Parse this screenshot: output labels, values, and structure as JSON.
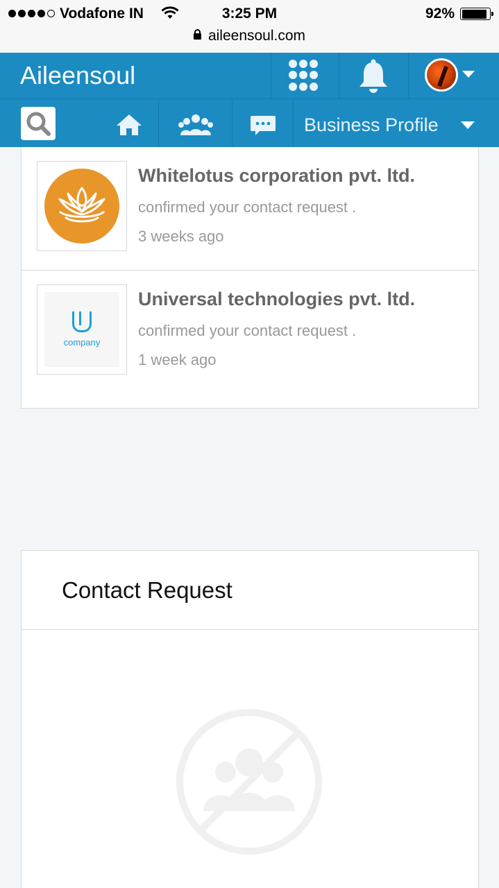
{
  "status_bar": {
    "carrier": "Vodafone IN",
    "time": "3:25 PM",
    "battery": "92%",
    "battery_level": 0.92,
    "url": "aileensoul.com"
  },
  "header": {
    "brand": "Aileensoul",
    "icons": [
      "apps-grid-icon",
      "bell-icon",
      "avatar"
    ]
  },
  "nav": {
    "icons": [
      "search-icon",
      "home-icon",
      "people-icon",
      "chat-icon"
    ],
    "profile_menu": "Business Profile"
  },
  "notifications": [
    {
      "company": "Whitelotus corporation pvt. ltd.",
      "message": "confirmed your contact request .",
      "time": "3 weeks ago",
      "logo": "lotus-logo"
    },
    {
      "company": "Universal technologies pvt. ltd.",
      "message": "confirmed your contact request .",
      "time": "1 week ago",
      "logo": "u-company-logo",
      "logo_text": "company"
    }
  ],
  "contact_request": {
    "title": "Contact Request",
    "empty_icon": "no-people-icon"
  },
  "colors": {
    "brand_blue": "#1b8bc2",
    "lotus_orange": "#e8952a",
    "u_blue": "#1ba0d8"
  }
}
